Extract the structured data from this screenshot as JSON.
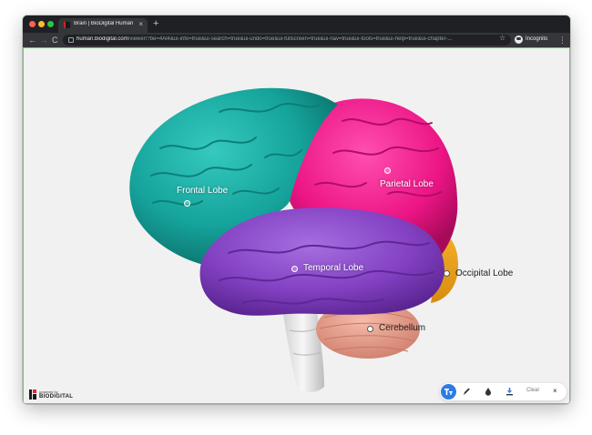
{
  "browser": {
    "tab_title": "Brain | BioDigital Human Platfo",
    "tab_close": "×",
    "new_tab": "+",
    "back": "←",
    "forward": "→",
    "reload": "C",
    "url_host": "human.biodigital.com",
    "url_path": "/viewer/?be=4Al4&ui-info=true&ui-search=true&ui-undo=true&ui-fullscreen=true&ui-nav=true&ui-tools=true&ui-help=true&ui-chapter-...",
    "bookmark": "☆",
    "profile_label": "Incognito",
    "menu": "⋮"
  },
  "annotations": [
    {
      "label": "Frontal Lobe"
    },
    {
      "label": "Parietal Lobe"
    },
    {
      "label": "Temporal Lobe"
    },
    {
      "label": "Occipital Lobe"
    },
    {
      "label": "Cerebellum"
    }
  ],
  "brand": {
    "small": "powered by",
    "name": "BIODIGITAL"
  },
  "tools": {
    "clear_label": "Clear",
    "close": "×",
    "icons": [
      "label-tool-icon",
      "pen-icon",
      "color-drop-icon",
      "download-icon",
      "close-icon"
    ]
  },
  "colors": {
    "frontal": "#1aa8a0",
    "parietal": "#f21b8e",
    "temporal": "#8a46c9",
    "occipital": "#e8a21a",
    "cerebellum": "#ec9f8c",
    "brainstem": "#e7e7e7",
    "active_tool": "#2d7be5",
    "viewport_border": "#5fd35f"
  }
}
